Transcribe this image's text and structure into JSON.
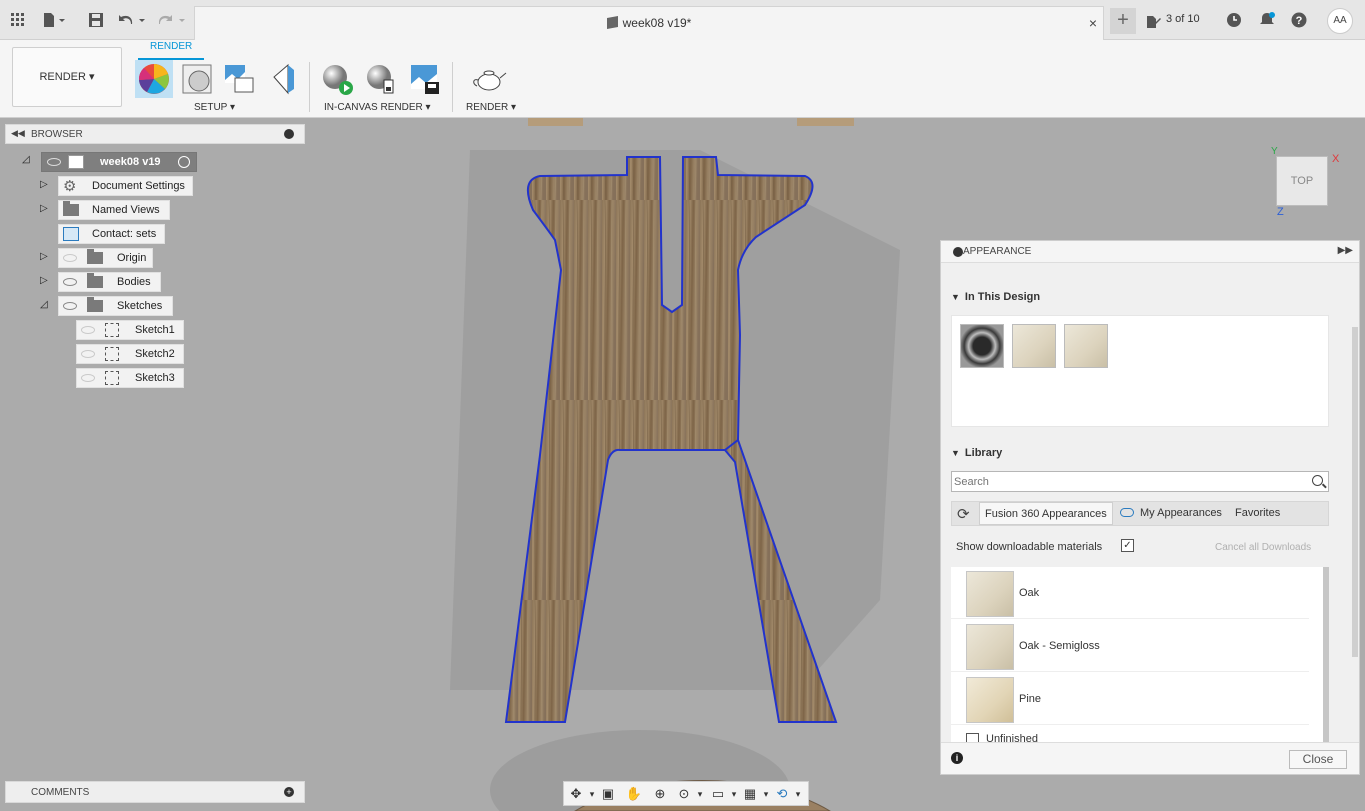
{
  "titlebar": {
    "doc_title": "week08 v19*",
    "version": "3 of 10",
    "avatar": "AA",
    "close_tab": "×",
    "new_tab": "+"
  },
  "toolbar": {
    "workspace": "RENDER ▾",
    "active_tab": "RENDER",
    "groups": {
      "setup": "SETUP ▾",
      "in_canvas": "IN-CANVAS RENDER ▾",
      "render": "RENDER ▾"
    }
  },
  "browser": {
    "title": "BROWSER",
    "root": "week08 v19",
    "items": [
      {
        "label": "Document Settings"
      },
      {
        "label": "Named Views"
      },
      {
        "label": "Contact: sets"
      },
      {
        "label": "Origin"
      },
      {
        "label": "Bodies"
      },
      {
        "label": "Sketches"
      },
      {
        "label": "Sketch1"
      },
      {
        "label": "Sketch2"
      },
      {
        "label": "Sketch3"
      }
    ]
  },
  "comments": {
    "title": "COMMENTS"
  },
  "viewcube": {
    "face": "TOP",
    "axis_x": "X",
    "axis_y": "Y",
    "axis_z": "Z"
  },
  "appearance": {
    "title": "APPEARANCE",
    "in_this_design": "In This Design",
    "library": "Library",
    "search_placeholder": "Search",
    "tabs": [
      "Fusion 360 Appearances",
      "My Appearances",
      "Favorites"
    ],
    "show_downloadable": "Show downloadable materials",
    "cancel_downloads": "Cancel all Downloads",
    "materials": [
      {
        "name": "Oak"
      },
      {
        "name": "Oak - Semigloss"
      },
      {
        "name": "Pine"
      }
    ],
    "folder": "Unfinished",
    "close": "Close",
    "info": "i"
  },
  "colors": {
    "accent": "#0696d7",
    "sketch_outline": "#2233cc",
    "canvas_bg": "#ababab"
  }
}
